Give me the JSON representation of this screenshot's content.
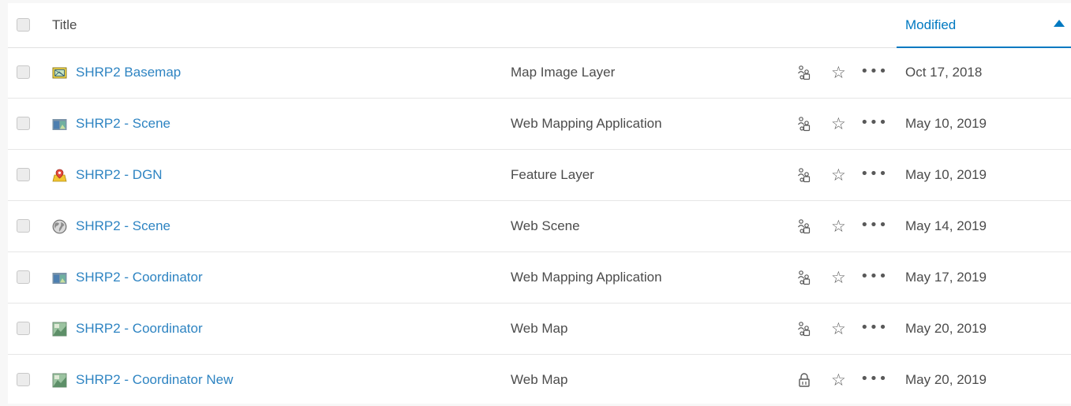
{
  "header": {
    "title_label": "Title",
    "modified_label": "Modified",
    "sort_direction": "ascending-indicator"
  },
  "colors": {
    "accent": "#0079c1",
    "link": "#2e84c2",
    "text": "#4c4c4c"
  },
  "items": [
    {
      "title": "SHRP2 Basemap",
      "type": "Map Image Layer",
      "icon": "map-image-layer-icon",
      "share_icon": "shared-groups-icon",
      "modified": "Oct 17, 2018"
    },
    {
      "title": "SHRP2 - Scene",
      "type": "Web Mapping Application",
      "icon": "web-app-icon",
      "share_icon": "shared-groups-icon",
      "modified": "May 10, 2019"
    },
    {
      "title": "SHRP2 - DGN",
      "type": "Feature Layer",
      "icon": "feature-layer-icon",
      "share_icon": "shared-groups-icon",
      "modified": "May 10, 2019"
    },
    {
      "title": "SHRP2 - Scene",
      "type": "Web Scene",
      "icon": "web-scene-globe-icon",
      "share_icon": "shared-groups-icon",
      "modified": "May 14, 2019"
    },
    {
      "title": "SHRP2 - Coordinator",
      "type": "Web Mapping Application",
      "icon": "web-app-icon",
      "share_icon": "shared-groups-icon",
      "modified": "May 17, 2019"
    },
    {
      "title": "SHRP2 - Coordinator",
      "type": "Web Map",
      "icon": "web-map-icon",
      "share_icon": "shared-groups-icon",
      "modified": "May 20, 2019"
    },
    {
      "title": "SHRP2 - Coordinator New",
      "type": "Web Map",
      "icon": "web-map-icon",
      "share_icon": "private-lock-icon",
      "modified": "May 20, 2019"
    }
  ]
}
